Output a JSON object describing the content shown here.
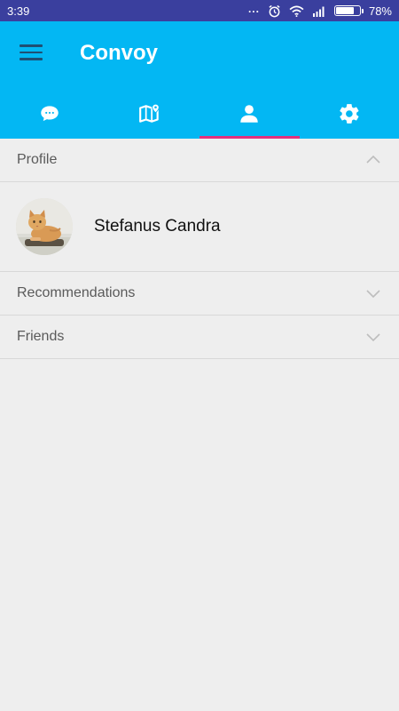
{
  "status_bar": {
    "time": "3:39",
    "dots": "...",
    "battery_percent": "78%",
    "battery_level": 0.78,
    "icons": [
      "more-dots-icon",
      "alarm-icon",
      "wifi-icon",
      "signal-icon",
      "battery-icon"
    ]
  },
  "app_bar": {
    "title": "Convoy",
    "menu_icon": "hamburger-menu-icon",
    "background_color": "#03b7f3",
    "tabs": [
      {
        "icon": "chat-bubble-icon",
        "active": false
      },
      {
        "icon": "map-icon",
        "active": false
      },
      {
        "icon": "person-icon",
        "active": true
      },
      {
        "icon": "gear-icon",
        "active": false
      }
    ],
    "active_indicator_color": "#e5307d"
  },
  "sections": {
    "profile": {
      "label": "Profile",
      "expanded": true,
      "chevron": "chevron-up-icon"
    },
    "recommendations": {
      "label": "Recommendations",
      "expanded": false,
      "chevron": "chevron-down-icon"
    },
    "friends": {
      "label": "Friends",
      "expanded": false,
      "chevron": "chevron-down-icon"
    }
  },
  "profile": {
    "name": "Stefanus Candra",
    "avatar": "cat-photo-avatar"
  }
}
